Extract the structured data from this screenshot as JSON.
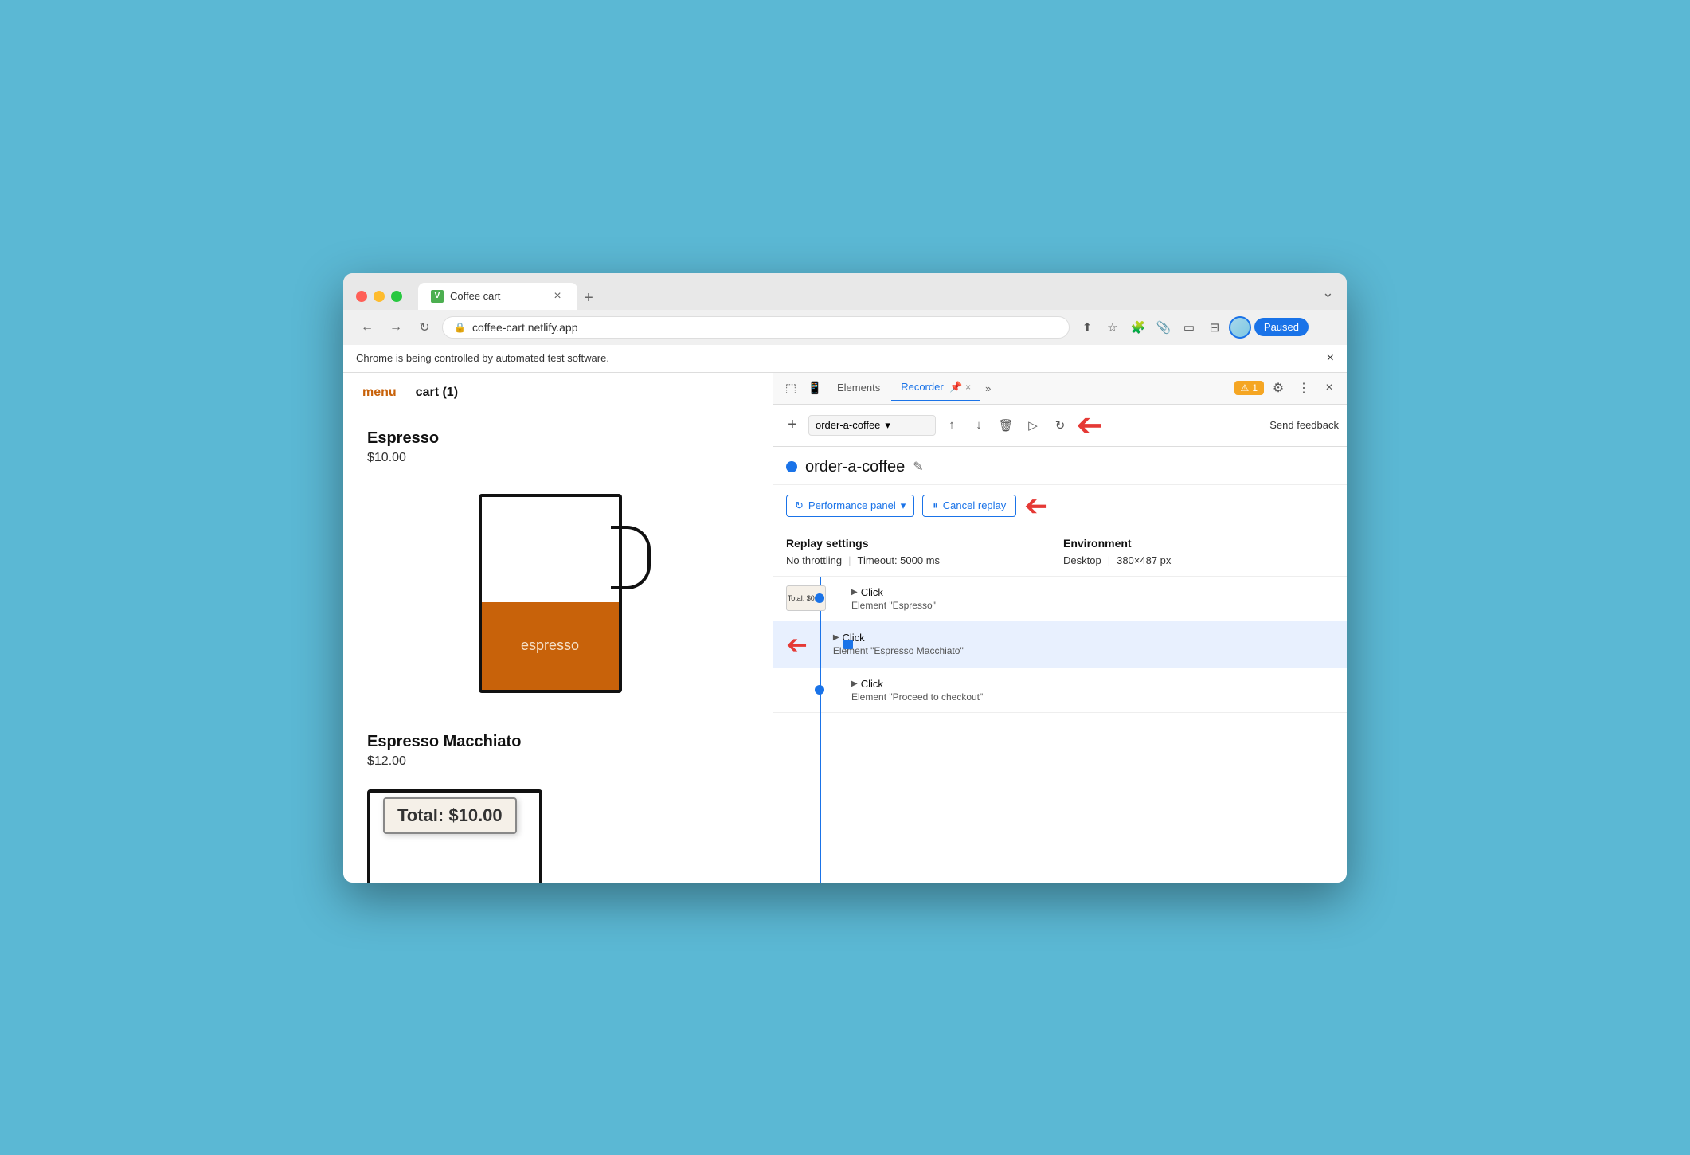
{
  "browser": {
    "tab_favicon": "V",
    "tab_title": "Coffee cart",
    "tab_close": "×",
    "new_tab": "+",
    "window_chevron": "⌄",
    "address": "coffee-cart.netlify.app",
    "back_arrow": "←",
    "forward_arrow": "→",
    "refresh": "↻",
    "star": "☆",
    "extension": "⧉",
    "ext2": "🔖",
    "split": "⊟",
    "paused_label": "Paused",
    "more_btn": "⋮",
    "automation_banner": "Chrome is being controlled by automated test software.",
    "banner_close": "×"
  },
  "website": {
    "nav_menu": "menu",
    "nav_cart": "cart (1)",
    "product1": {
      "name": "Espresso",
      "price": "$10.00",
      "label": "espresso"
    },
    "product2": {
      "name": "Espresso Macchiato",
      "price": "$12.00"
    },
    "total_label": "Total: $10.00"
  },
  "devtools": {
    "tabs": [
      "Elements",
      "Recorder",
      ""
    ],
    "tab_recorder_label": "Recorder",
    "tab_elements_label": "Elements",
    "tab_close": "×",
    "tab_more": "»",
    "badge_label": "1",
    "settings_icon": "⚙",
    "more_icon": "⋮",
    "close_icon": "×",
    "toolbar": {
      "add_icon": "+",
      "recording_name": "order-a-coffee",
      "dropdown_arrow": "▾",
      "upload_icon": "↑",
      "download_icon": "↓",
      "delete_icon": "🗑",
      "replay_icon": "▷",
      "slow_replay_icon": "↻",
      "send_feedback": "Send feedback"
    },
    "recorder": {
      "dot_color": "#1a73e8",
      "name": "order-a-coffee",
      "edit_icon": "✎",
      "perf_panel": "Performance panel",
      "dropdown_arrow": "▾",
      "cancel_replay_icon": "⏸",
      "cancel_replay_label": "Cancel replay"
    },
    "replay_settings": {
      "title": "Replay settings",
      "env_title": "Environment",
      "no_throttle": "No throttling",
      "timeout": "Timeout: 5000 ms",
      "desktop": "Desktop",
      "resolution": "380×487 px"
    },
    "timeline": {
      "items": [
        {
          "has_thumb": true,
          "thumb_text": "Total: $0.00",
          "action": "Click",
          "description": "Element \"Espresso\"",
          "highlighted": false
        },
        {
          "has_thumb": false,
          "action": "Click",
          "description": "Element \"Espresso Macchiato\"",
          "highlighted": true
        },
        {
          "has_thumb": false,
          "action": "Click",
          "description": "Element \"Proceed to checkout\"",
          "highlighted": false
        }
      ]
    }
  },
  "arrows": {
    "toolbar_arrow": "→",
    "cancel_arrow": "→",
    "timeline_arrow": "→"
  }
}
